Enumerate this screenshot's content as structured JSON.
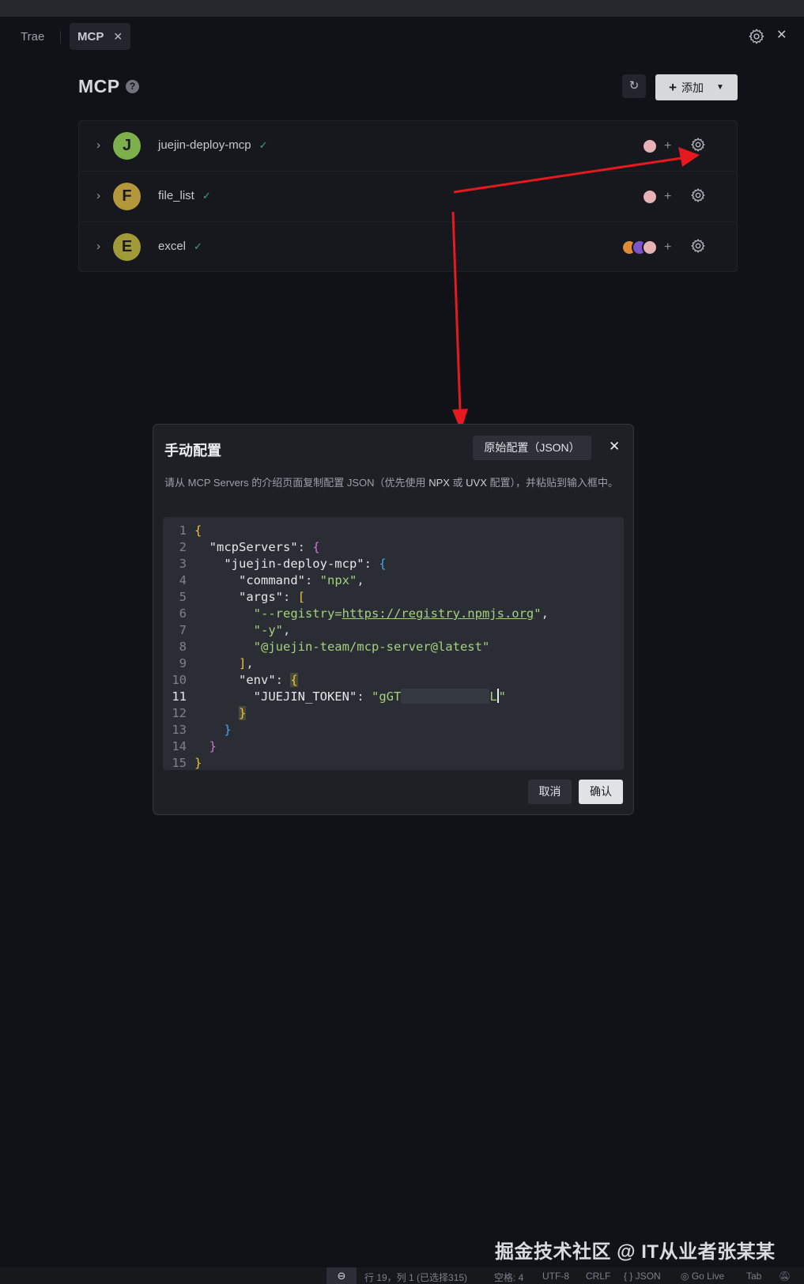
{
  "tabs": [
    {
      "label": "Trae"
    },
    {
      "label": "MCP",
      "close_icon": "close-icon"
    }
  ],
  "page": {
    "title": "MCP",
    "help_icon": "question-circle-icon",
    "refresh_icon": "refresh-icon",
    "add_button": {
      "label": "添加",
      "icon": "plus-icon",
      "dropdown_icon": "chevron-down-icon"
    }
  },
  "servers": [
    {
      "initial": "J",
      "name": "juejin-deploy-mcp",
      "status": "connected",
      "avatar_color": "#7bb04a",
      "tool_chip_colors": [
        "#e6b2b4"
      ]
    },
    {
      "initial": "F",
      "name": "file_list",
      "status": "connected",
      "avatar_color": "#b3973a",
      "tool_chip_colors": [
        "#e6b2b4"
      ]
    },
    {
      "initial": "E",
      "name": "excel",
      "status": "connected",
      "avatar_color": "#a09a39",
      "tool_chip_colors": [
        "#e08a35",
        "#7b54c9",
        "#e6b2b4"
      ]
    }
  ],
  "modal": {
    "title": "手动配置",
    "raw_config_button": "原始配置（JSON）",
    "description_parts": [
      "请从 MCP Servers 的介绍页面复制配置 JSON（优先使用 ",
      "NPX",
      " 或 ",
      "UVX",
      " 配置），并粘贴到输入框中。"
    ],
    "code": {
      "line_numbers": [
        "1",
        "2",
        "3",
        "4",
        "5",
        "6",
        "7",
        "8",
        "9",
        "10",
        "11",
        "12",
        "13",
        "14",
        "15"
      ],
      "active_line": "11",
      "key_mcpServers": "\"mcpServers\"",
      "key_server": "\"juejin-deploy-mcp\"",
      "key_command": "\"command\"",
      "val_command": "\"npx\"",
      "key_args": "\"args\"",
      "arg1_prefix": "\"--registry=",
      "arg1_url": "https://registry.npmjs.org",
      "arg1_suffix": "\"",
      "arg2": "\"-y\"",
      "arg3": "\"@juejin-team/mcp-server@latest\"",
      "key_env": "\"env\"",
      "key_token": "\"JUEJIN_TOKEN\"",
      "token_visible_start": "\"gGT",
      "token_visible_end": "L",
      "token_quote_end": "\""
    },
    "cancel_button": "取消",
    "confirm_button": "确认"
  },
  "watermark": "掘金技术社区 @ IT从业者张某某",
  "status_bar": {
    "zoom_icon": "zoom-out-icon",
    "position": "行 19，列 1 (已选择315)",
    "indent": "空格: 4",
    "encoding": "UTF-8",
    "eol": "CRLF",
    "language": "{ } JSON",
    "go_live": "Go Live",
    "tab": "Tab",
    "notifications_icon": "bell-off-icon"
  },
  "annotation_color": "#e5191f"
}
